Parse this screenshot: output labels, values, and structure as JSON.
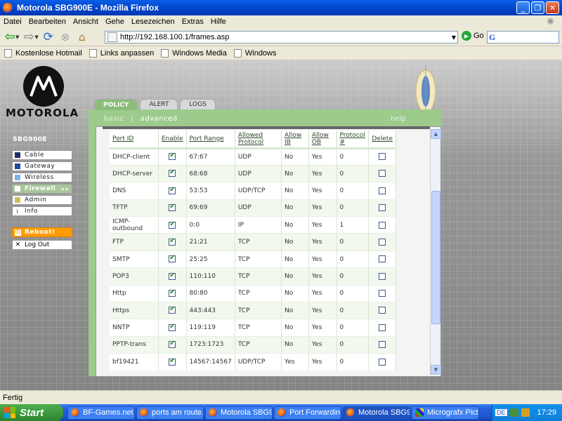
{
  "window": {
    "title": "Motorola SBG900E - Mozilla Firefox"
  },
  "menu": [
    "Datei",
    "Bearbeiten",
    "Ansicht",
    "Gehe",
    "Lesezeichen",
    "Extras",
    "Hilfe"
  ],
  "navigation": {
    "url": "http://192.168.100.1/frames.asp",
    "go_label": "Go",
    "search_engine": "G"
  },
  "bookmarks": [
    "Kostenlose Hotmail",
    "Links anpassen",
    "Windows Media",
    "Windows"
  ],
  "router": {
    "brand": "MOTOROLA",
    "model": "SBG900E",
    "tabs": [
      "POLICY",
      "ALERT",
      "LOGS"
    ],
    "subnav": {
      "basic": "basic",
      "separator": "|",
      "advanced": "advanced",
      "help": "help"
    },
    "sidebar": [
      {
        "label": "Cable",
        "color": "#1f2f6b"
      },
      {
        "label": "Gateway",
        "color": "#1f4b9b"
      },
      {
        "label": "Wireless",
        "color": "#7eb3e8"
      },
      {
        "label": "Firewall",
        "color": "#ffffff"
      },
      {
        "label": "Admin",
        "color": "#c8c05a"
      },
      {
        "label": "Info",
        "color": "info"
      }
    ],
    "reboot_label": "Reboot!",
    "logout_label": "Log Out"
  },
  "table": {
    "headers": [
      "Port ID",
      "Enable",
      "Port Range",
      "Allowed Protocol",
      "Allow IB",
      "Allow OB",
      "Protocol #",
      "Delete"
    ],
    "rows": [
      {
        "id": "DHCP-client",
        "enabled": true,
        "range": "67:67",
        "protocol": "UDP",
        "ib": "No",
        "ob": "Yes",
        "num": "0"
      },
      {
        "id": "DHCP-server",
        "enabled": true,
        "range": "68:68",
        "protocol": "UDP",
        "ib": "No",
        "ob": "Yes",
        "num": "0"
      },
      {
        "id": "DNS",
        "enabled": true,
        "range": "53:53",
        "protocol": "UDP/TCP",
        "ib": "No",
        "ob": "Yes",
        "num": "0"
      },
      {
        "id": "TFTP",
        "enabled": true,
        "range": "69:69",
        "protocol": "UDP",
        "ib": "No",
        "ob": "Yes",
        "num": "0"
      },
      {
        "id": "ICMP-outbound",
        "enabled": true,
        "range": "0:0",
        "protocol": "IP",
        "ib": "No",
        "ob": "Yes",
        "num": "1"
      },
      {
        "id": "FTP",
        "enabled": true,
        "range": "21:21",
        "protocol": "TCP",
        "ib": "No",
        "ob": "Yes",
        "num": "0"
      },
      {
        "id": "SMTP",
        "enabled": true,
        "range": "25:25",
        "protocol": "TCP",
        "ib": "No",
        "ob": "Yes",
        "num": "0"
      },
      {
        "id": "POP3",
        "enabled": true,
        "range": "110:110",
        "protocol": "TCP",
        "ib": "No",
        "ob": "Yes",
        "num": "0"
      },
      {
        "id": "Http",
        "enabled": true,
        "range": "80:80",
        "protocol": "TCP",
        "ib": "No",
        "ob": "Yes",
        "num": "0"
      },
      {
        "id": "Https",
        "enabled": true,
        "range": "443:443",
        "protocol": "TCP",
        "ib": "No",
        "ob": "Yes",
        "num": "0"
      },
      {
        "id": "NNTP",
        "enabled": true,
        "range": "119:119",
        "protocol": "TCP",
        "ib": "No",
        "ob": "Yes",
        "num": "0"
      },
      {
        "id": "PPTP-trans",
        "enabled": true,
        "range": "1723:1723",
        "protocol": "TCP",
        "ib": "No",
        "ob": "Yes",
        "num": "0"
      },
      {
        "id": "bf19421",
        "enabled": true,
        "range": "14567:14567",
        "protocol": "UDP/TCP",
        "ib": "Yes",
        "ob": "Yes",
        "num": "0"
      }
    ]
  },
  "status": "Fertig",
  "taskbar": {
    "start": "Start",
    "tasks": [
      "BF-Games.net ...",
      "ports am route...",
      "Motorola SBG9...",
      "Port Forwardin...",
      "Motorola SBG9...",
      "Micrografx Pict..."
    ],
    "lang": "DE",
    "clock": "17:29"
  }
}
